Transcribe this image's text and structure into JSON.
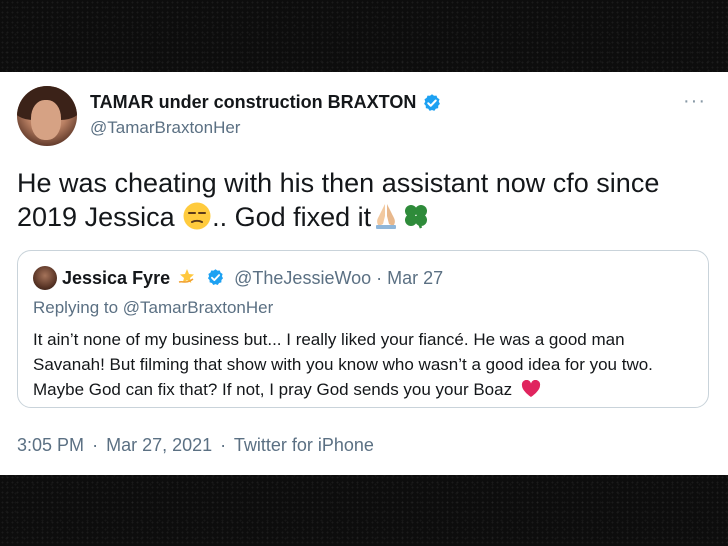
{
  "tweet": {
    "author_name": "TAMAR under construction BRAXTON",
    "author_handle": "@TamarBraxtonHer",
    "text_line1": "He was cheating with his then assistant now cfo since",
    "text_line2_a": "2019 Jessica ",
    "text_line2_b": ".. God fixed it",
    "more_label": "···",
    "time": "3:05 PM",
    "date": "Mar 27, 2021",
    "source": "Twitter for iPhone",
    "separator": "·"
  },
  "quoted": {
    "author_name": "Jessica Fyre",
    "author_handle": "@TheJessieWoo",
    "date": "Mar 27",
    "separator": "·",
    "replying_prefix": "Replying to ",
    "replying_to": "@TamarBraxtonHer",
    "text": "It ain’t none of my business but... I really liked your fiancé. He was a good man Savanah! But filming that show with you know who wasn’t a good idea for you two. Maybe God can fix that? If not, I pray God sends you your Boaz"
  },
  "colors": {
    "verified": "#1da1f2",
    "heart": "#e0245e",
    "clover": "#2e8b3a"
  },
  "icons": [
    "verified-icon",
    "unamused-face-icon",
    "praying-hands-icon",
    "four-leaf-clover-icon",
    "dizzy-star-icon",
    "red-heart-icon",
    "more-icon"
  ]
}
